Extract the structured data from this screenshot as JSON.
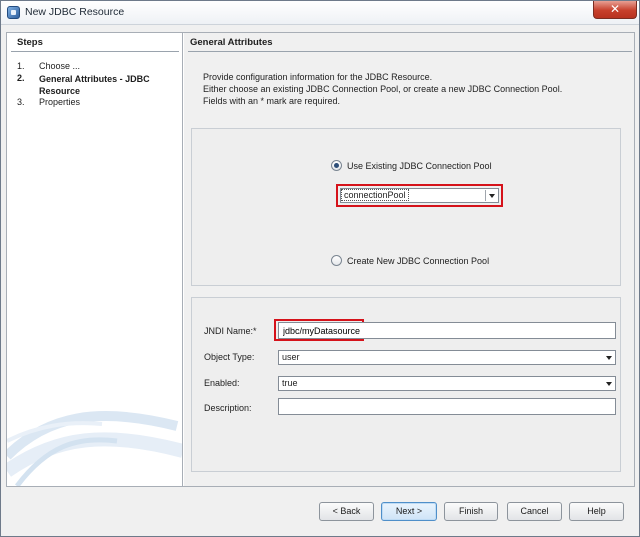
{
  "window": {
    "title": "New JDBC Resource",
    "close_symbol": "✕",
    "icon": "app-icon"
  },
  "steps": {
    "heading": "Steps",
    "items": [
      {
        "num": "1.",
        "label": "Choose ...",
        "active": false
      },
      {
        "num": "2.",
        "label": "General Attributes - JDBC Resource",
        "active": true
      },
      {
        "num": "3.",
        "label": "Properties",
        "active": false
      }
    ]
  },
  "main": {
    "heading": "General Attributes",
    "intro": [
      "Provide configuration information for the JDBC Resource.",
      "Either choose an existing JDBC Connection Pool, or create a new JDBC Connection Pool.",
      "Fields with an * mark are required."
    ],
    "pool": {
      "use_existing_label": "Use Existing JDBC Connection Pool",
      "use_existing_selected": true,
      "pool_value": "connectionPool",
      "create_new_label": "Create New JDBC Connection Pool",
      "create_new_selected": false
    },
    "form": {
      "jndi_label": "JNDI Name:*",
      "jndi_value": "jdbc/myDatasource",
      "object_type_label": "Object Type:",
      "object_type_value": "user",
      "enabled_label": "Enabled:",
      "enabled_value": "true",
      "description_label": "Description:",
      "description_value": ""
    }
  },
  "footer": {
    "back": "< Back",
    "next": "Next >",
    "finish": "Finish",
    "cancel": "Cancel",
    "help": "Help"
  },
  "colors": {
    "highlight": "#d5121a",
    "panel": "#f0f0f0",
    "accent": "#4f8fc9"
  }
}
